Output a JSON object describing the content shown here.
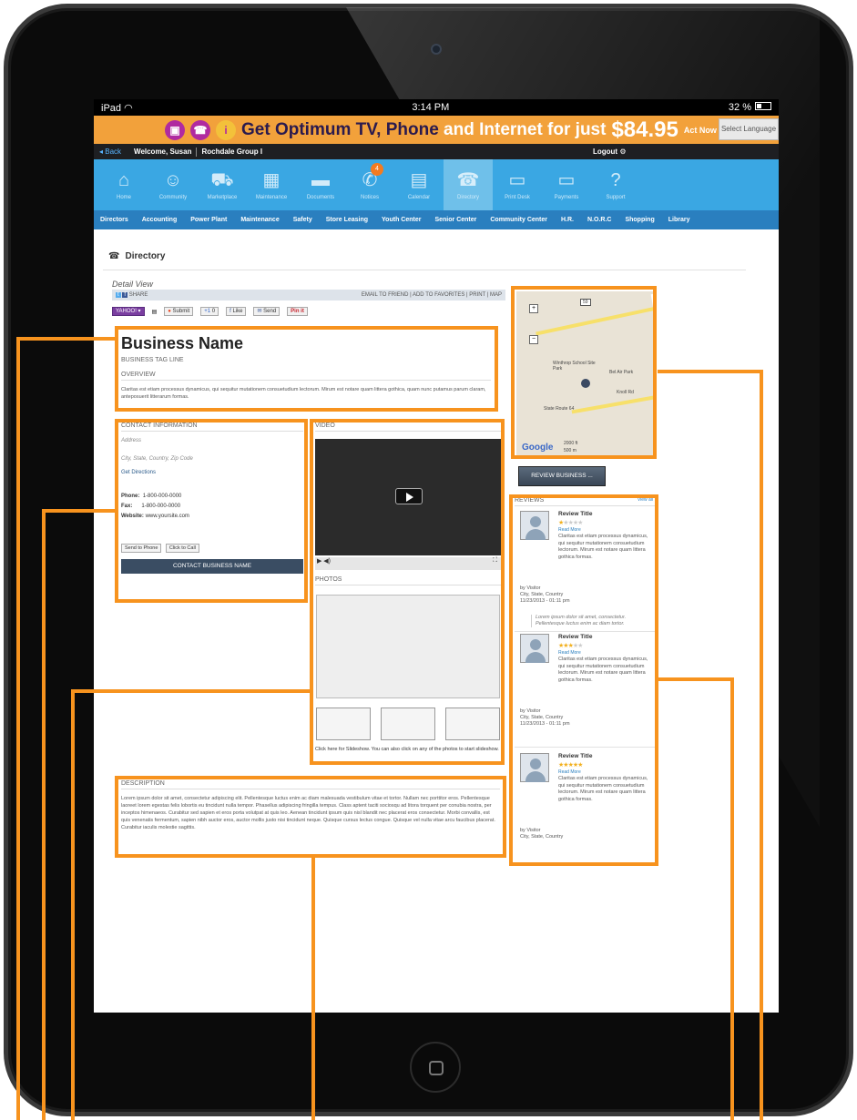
{
  "status_bar": {
    "device": "iPad",
    "time": "3:14 PM",
    "battery": "32 %"
  },
  "ad_banner": {
    "icons": [
      "tv-icon",
      "phone-icon",
      "info-icon"
    ],
    "headline_bold": "Get Optimum TV, Phone",
    "headline_light": "and Internet for just",
    "price": "$84.95",
    "price_note": "Act Now Free Router",
    "language_button": "Select Language"
  },
  "user_bar": {
    "back": "◂ Back",
    "welcome": "Welcome, Susan",
    "group": "Rochdale Group I",
    "logout": "Logout"
  },
  "nav_icons": [
    {
      "label": "Home",
      "icon": "home-icon"
    },
    {
      "label": "Community",
      "icon": "people-icon"
    },
    {
      "label": "Marketplace",
      "icon": "cart-icon"
    },
    {
      "label": "Maintenance",
      "icon": "briefcase-icon"
    },
    {
      "label": "Documents",
      "icon": "folder-icon"
    },
    {
      "label": "Notices",
      "icon": "megaphone-icon",
      "badge": "4"
    },
    {
      "label": "Calendar",
      "icon": "calendar-icon"
    },
    {
      "label": "Directory",
      "icon": "phone-icon",
      "active": true
    },
    {
      "label": "Print Desk",
      "icon": "monitor-icon"
    },
    {
      "label": "Payments",
      "icon": "card-icon"
    },
    {
      "label": "Support",
      "icon": "help-icon"
    }
  ],
  "categories": [
    "Directors",
    "Accounting",
    "Power Plant",
    "Maintenance",
    "Safety",
    "Store Leasing",
    "Youth Center",
    "Senior Center",
    "Community Center",
    "H.R.",
    "N.O.R.C",
    "Shopping",
    "Library"
  ],
  "page_title": "Directory",
  "detail": {
    "label": "Detail View",
    "share": "SHARE",
    "share_links": "EMAIL TO FRIEND | ADD TO FAVORITES | PRINT | MAP",
    "social": {
      "yahoo": "YAHOO! ▾",
      "submit": "Submit",
      "count": "0",
      "like": "Like",
      "send": "Send",
      "pinit": "Pin it"
    }
  },
  "business": {
    "name": "Business Name",
    "tagline": "BUSINESS TAG LINE",
    "overview_label": "OVERVIEW",
    "overview": "Claritas est etiam processus dynamicus, qui sequitur mutationem consuetudium lectorum. Mirum est notare quam littera gothica, quam nunc putamus parum claram, anteposuerit litterarum formas."
  },
  "contact": {
    "label": "CONTACT INFORMATION",
    "address": "Address",
    "city": "City, State, Country, Zip Code",
    "directions": "Get Directions",
    "phone_label": "Phone:",
    "phone": "1-800-000-0000",
    "fax_label": "Fax:",
    "fax": "1-800-000-0000",
    "website_label": "Website:",
    "website": "www.yoursite.com",
    "send_to_phone": "Send to Phone",
    "click_to_call": "Click to Call",
    "cta": "CONTACT BUSINESS NAME"
  },
  "media": {
    "video_label": "VIDEO",
    "photos_label": "PHOTOS",
    "slideshow_note": "Click here for Slideshow. You can also click on any of the photos to start slideshow."
  },
  "description": {
    "label": "DESCRIPTION",
    "text": "Lorem ipsum dolor sit amet, consectetur adipiscing elit. Pellentesque luctus enim ac diam malesuada vestibulum vitae et tortor. Nullam nec porttitor eros. Pellentesque laoreet lorem egestas felis lobortis eu tincidunt nulla tempor. Phasellus adipiscing fringilla tempus. Class aptent taciti sociosqu ad litora torquent per conubia nostra, per inceptos himenaeos. Curabitur sed sapien et eros porta volutpat at quis leo. Aenean tincidunt ipsum quis nisl blandit nec placerat eros consectetur. Morbi convallis, est quis venenatis fermentum, sapien nibh auctor eros, auctor mollis justo nisi tincidunt neque. Quisque cursus lectus congue. Quisque vel nulla vitae arcu faucibus placerat. Curabitur iaculis molestie sagittis."
  },
  "map": {
    "labels": [
      "Winthrop School Site Park",
      "Bel Air Park",
      "State Route 64",
      "Knoll Rd",
      "Google",
      "2000 ft",
      "500 m"
    ],
    "route_shield": "59"
  },
  "review_button": "REVIEW BUSINESS ...",
  "reviews": {
    "label": "REVIEWS",
    "view_all": "View all",
    "items": [
      {
        "title": "Review Title",
        "stars": 1,
        "read_more": "Read More",
        "body": "Claritas est etiam processus dynamicus, qui sequitur mutationem consuetudium lectorum. Mirum est notare quam littera gothica formas.",
        "by": "by Visitor",
        "location": "City, State, Country",
        "date": "11/23/2013 - 01:11 pm",
        "quote": "Lorem ipsum dolor sit amet, consectetur. Pellentesque luctus enim ac diam tortor."
      },
      {
        "title": "Review Title",
        "stars": 3,
        "read_more": "Read More",
        "body": "Claritas est etiam processus dynamicus, qui sequitur mutationem consuetudium lectorum. Mirum est notare quam littera gothica formas.",
        "by": "by Visitor",
        "location": "City, State, Country",
        "date": "11/23/2013 - 01:11 pm"
      },
      {
        "title": "Review Title",
        "stars": 5,
        "read_more": "Read More",
        "body": "Claritas est etiam processus dynamicus, qui sequitur mutationem consuetudium lectorum. Mirum est notare quam littera gothica formas.",
        "by": "by Visitor",
        "location": "City, State, Country"
      }
    ]
  },
  "colors": {
    "callout": "#f7931e",
    "nav_blue": "#3aa7e3",
    "cat_blue": "#2a7fbf",
    "ad_orange": "#f2a13b",
    "cta_dark": "#3a4d63"
  }
}
